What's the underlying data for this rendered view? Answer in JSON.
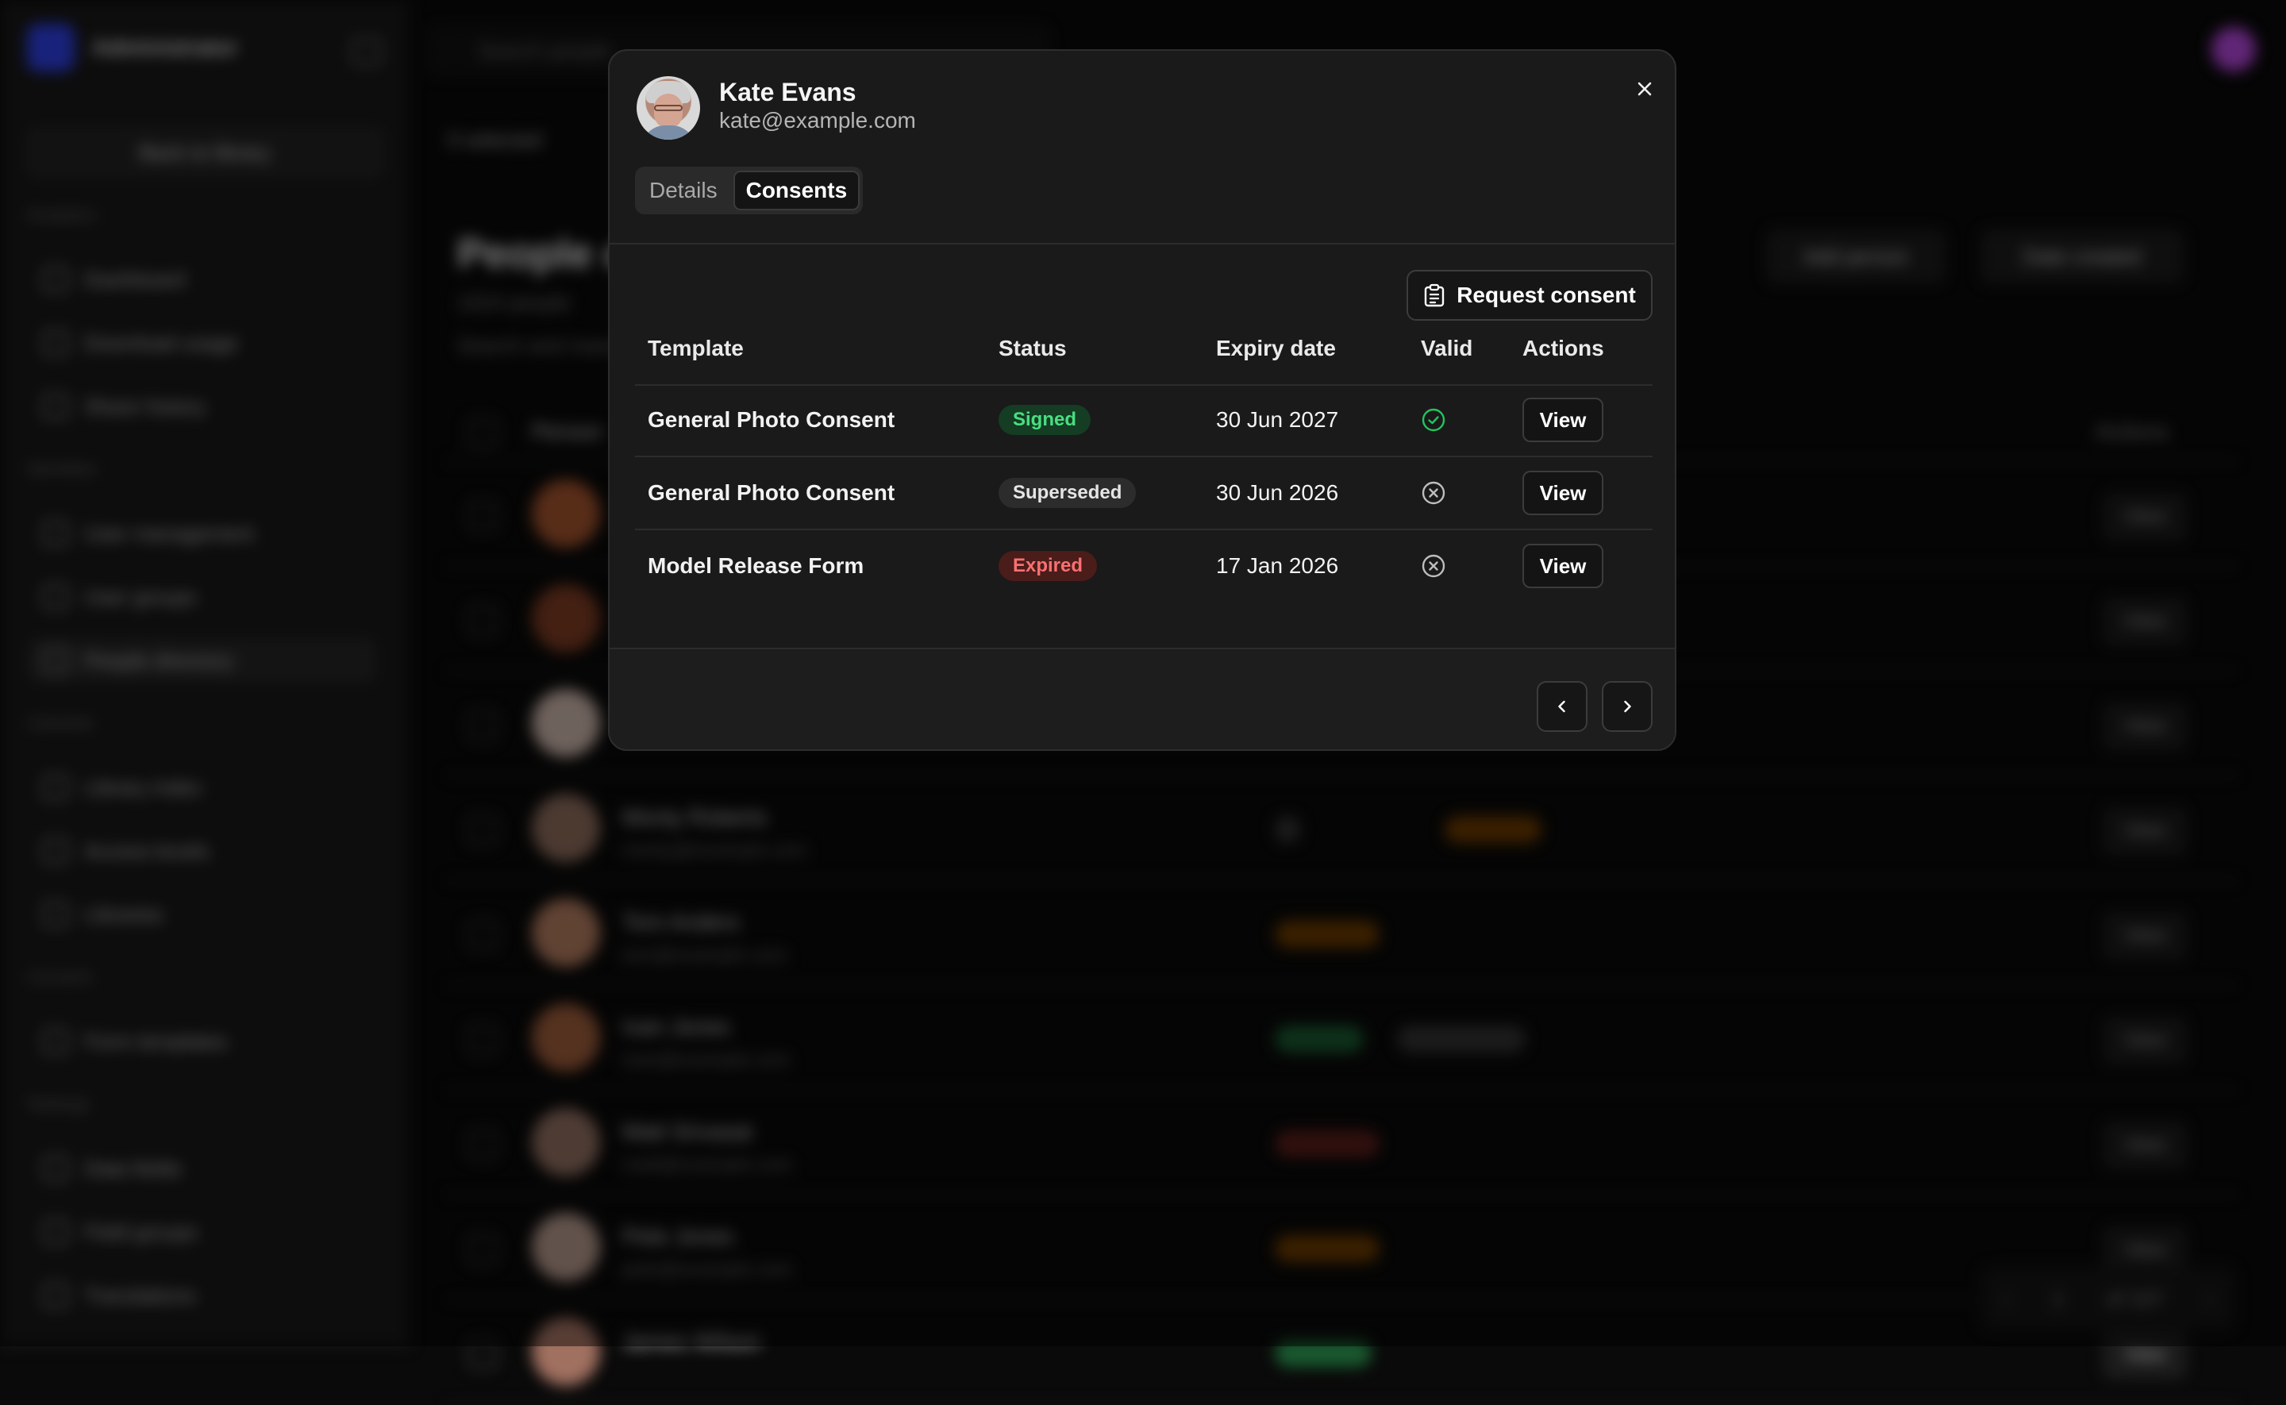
{
  "app": {
    "brand_title": "Administrator",
    "back_label": "Back to library",
    "search_placeholder": "Search people",
    "selected_label": "0 selected",
    "page_title": "People directory",
    "page_count": "1024 people",
    "page_desc": "Search and manage people",
    "add_person_label": "Add person",
    "sort_label": "Date created"
  },
  "sidebar": {
    "sections": [
      {
        "label": "Analytics",
        "items": [
          "Dashboard",
          "Download usage",
          "Share history"
        ]
      },
      {
        "label": "Identities",
        "items": [
          "User management",
          "User groups",
          "People directory"
        ]
      },
      {
        "label": "Libraries",
        "items": [
          "Library index",
          "Access levels",
          "Libraries"
        ]
      },
      {
        "label": "Consent",
        "items": [
          "Form templates"
        ]
      },
      {
        "label": "Settings",
        "items": [
          "Data fields",
          "Field groups",
          "Translations"
        ]
      }
    ]
  },
  "background_table": {
    "person_header": "Person",
    "actions_header": "Actions",
    "view_label": "View",
    "rows": [
      {
        "name": "",
        "email": ""
      },
      {
        "name": "",
        "email": ""
      },
      {
        "name": "",
        "email": ""
      },
      {
        "name": "Monty Roberts",
        "email": "monty@example.com"
      },
      {
        "name": "Tom Anders",
        "email": "tom@example.com"
      },
      {
        "name": "Ivan Jones",
        "email": "ivan@example.com"
      },
      {
        "name": "Matt Srivasat",
        "email": "matt@example.com"
      },
      {
        "name": "Pete Jones",
        "email": "pete@example.com"
      },
      {
        "name": "James Wilson",
        "email": ""
      }
    ],
    "pager": {
      "page": "1",
      "of_label": "of 107"
    }
  },
  "modal": {
    "person": {
      "name": "Kate Evans",
      "email": "kate@example.com"
    },
    "tabs": [
      {
        "label": "Details",
        "active": false
      },
      {
        "label": "Consents",
        "active": true
      }
    ],
    "request_consent_label": "Request consent",
    "table": {
      "headers": {
        "template": "Template",
        "status": "Status",
        "expiry": "Expiry date",
        "valid": "Valid",
        "actions": "Actions"
      },
      "rows": [
        {
          "template": "General Photo Consent",
          "status": "Signed",
          "expiry": "30 Jun 2027",
          "valid": true,
          "action": "View"
        },
        {
          "template": "General Photo Consent",
          "status": "Superseded",
          "expiry": "30 Jun 2026",
          "valid": false,
          "action": "View"
        },
        {
          "template": "Model Release Form",
          "status": "Expired",
          "expiry": "17 Jan 2026",
          "valid": false,
          "action": "View"
        }
      ]
    },
    "pagination": {
      "prev_icon": "chevron-left-icon",
      "next_icon": "chevron-right-icon"
    }
  },
  "colors": {
    "signed_bg": "#143d24",
    "signed_fg": "#4ade80",
    "superseded_bg": "#2c2c2c",
    "superseded_fg": "#e5e5e5",
    "expired_bg": "#4a1c1a",
    "expired_fg": "#f87171",
    "valid_icon": "#22c55e",
    "invalid_icon": "#bdbdbd"
  }
}
